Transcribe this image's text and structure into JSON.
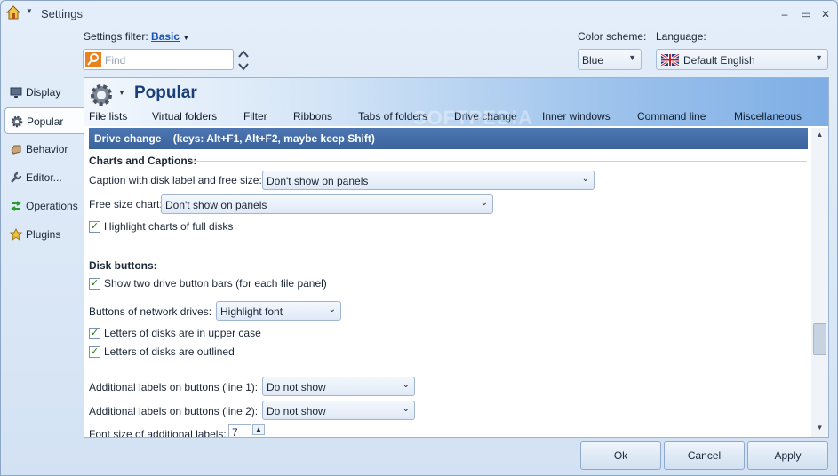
{
  "window": {
    "title": "Settings",
    "controls": {
      "minimize": "‒",
      "restore": "▭",
      "close": "✕"
    }
  },
  "filter": {
    "label": "Settings filter:",
    "value": "Basic",
    "search_placeholder": "Find"
  },
  "color_scheme": {
    "label": "Color scheme:",
    "value": "Blue"
  },
  "language": {
    "label": "Language:",
    "value": "Default English"
  },
  "sidebar": {
    "items": [
      {
        "label": "Display",
        "icon": "monitor-icon",
        "active": false
      },
      {
        "label": "Popular",
        "icon": "gear-icon",
        "active": true
      },
      {
        "label": "Behavior",
        "icon": "hand-icon",
        "active": false
      },
      {
        "label": "Editor...",
        "icon": "wrench-icon",
        "active": false
      },
      {
        "label": "Operations",
        "icon": "arrows-icon",
        "active": false
      },
      {
        "label": "Plugins",
        "icon": "puzzle-icon",
        "active": false
      }
    ]
  },
  "panel": {
    "title": "Popular",
    "watermark": "SOFTPEDIA",
    "tabs": [
      "File lists",
      "Virtual folders",
      "Filter",
      "Ribbons",
      "Tabs of folders",
      "Drive change",
      "Inner windows",
      "Command line",
      "Miscellaneous"
    ],
    "section_title": "Drive change    (keys: Alt+F1, Alt+F2, maybe keep Shift)"
  },
  "charts_group": {
    "heading": "Charts and Captions:",
    "caption_label": "Caption with disk label and free size:",
    "caption_value": "Don't show on panels",
    "free_size_label": "Free size chart:",
    "free_size_value": "Don't show on panels",
    "highlight_label": "Highlight charts of full disks",
    "highlight_checked": true
  },
  "disk_group": {
    "heading": "Disk buttons:",
    "two_bars_label": "Show two drive button bars (for each file panel)",
    "two_bars_checked": true,
    "network_label": "Buttons of network drives:",
    "network_value": "Highlight font",
    "upper_case_label": "Letters of disks are in upper case",
    "upper_case_checked": true,
    "outlined_label": "Letters of disks are outlined",
    "outlined_checked": true,
    "line1_label": "Additional labels on buttons (line 1):",
    "line1_value": "Do not show",
    "line2_label": "Additional labels on buttons (line 2):",
    "line2_value": "Do not show",
    "font_size_label": "Font size of additional labels:",
    "font_size_value": "7"
  },
  "buttons": {
    "ok": "Ok",
    "cancel": "Cancel",
    "apply": "Apply"
  }
}
